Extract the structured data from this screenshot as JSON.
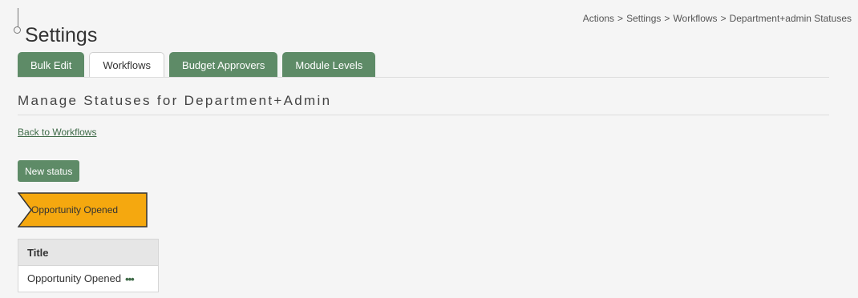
{
  "header": {
    "title": "Settings",
    "breadcrumb": [
      "Actions",
      ">",
      "Settings",
      ">",
      "Workflows",
      ">",
      "Department+admin Statuses"
    ]
  },
  "tabs": [
    {
      "label": "Bulk Edit",
      "active": false
    },
    {
      "label": "Workflows",
      "active": true
    },
    {
      "label": "Budget Approvers",
      "active": false
    },
    {
      "label": "Module Levels",
      "active": false
    }
  ],
  "main": {
    "heading": "Manage Statuses for Department+Admin",
    "back_link": "Back to Workflows",
    "new_status_label": "New status",
    "status_chevron_label": "Opportunity Opened",
    "table": {
      "headers": [
        "Title"
      ],
      "rows": [
        {
          "title": "Opportunity Opened",
          "actions_icon": "ellipsis-icon"
        }
      ]
    }
  },
  "colors": {
    "tab_green": "#5e8b67",
    "status_orange": "#f5a80f",
    "link_green": "#3f6b48"
  }
}
